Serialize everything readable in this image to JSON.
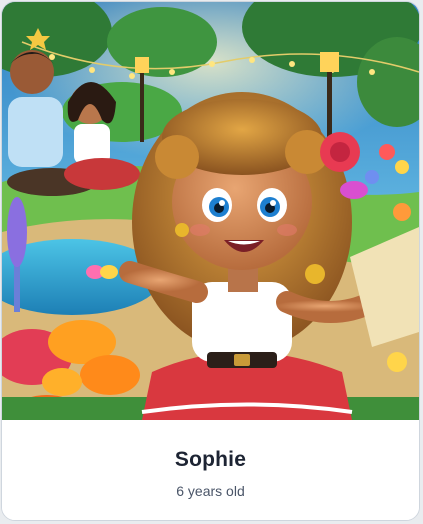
{
  "card": {
    "name": "Sophie",
    "age_label": "6 years old",
    "image_icon": "illustration-girl-in-garden"
  },
  "colors": {
    "name_text": "#1d2433",
    "age_text": "#4a5568",
    "card_border": "#cfd6de"
  }
}
